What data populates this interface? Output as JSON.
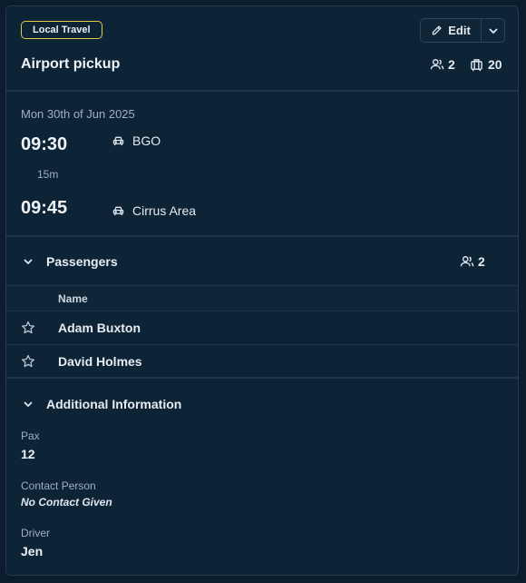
{
  "header": {
    "badge": "Local Travel",
    "edit_label": "Edit",
    "title": "Airport pickup",
    "people_count": "2",
    "luggage_count": "20"
  },
  "schedule": {
    "date": "Mon 30th of Jun 2025",
    "departure": {
      "time": "09:30",
      "location": "BGO"
    },
    "duration": "15m",
    "arrival": {
      "time": "09:45",
      "location": "Cirrus Area"
    }
  },
  "passengers": {
    "title": "Passengers",
    "count": "2",
    "column_name": "Name",
    "rows": [
      {
        "name": "Adam Buxton"
      },
      {
        "name": "David Holmes"
      }
    ]
  },
  "additional": {
    "title": "Additional Information",
    "pax_label": "Pax",
    "pax_value": "12",
    "contact_label": "Contact Person",
    "contact_value": "No Contact Given",
    "driver_label": "Driver",
    "driver_value": "Jen"
  },
  "colors": {
    "background": "#0b1d2c",
    "card": "#0d2336",
    "badge_border": "#e6c84d",
    "text": "#e5ecf2",
    "muted": "#9fb0c0"
  },
  "icons": [
    "pencil-icon",
    "chevron-down-icon",
    "people-icon",
    "luggage-icon",
    "car-icon",
    "star-icon"
  ]
}
